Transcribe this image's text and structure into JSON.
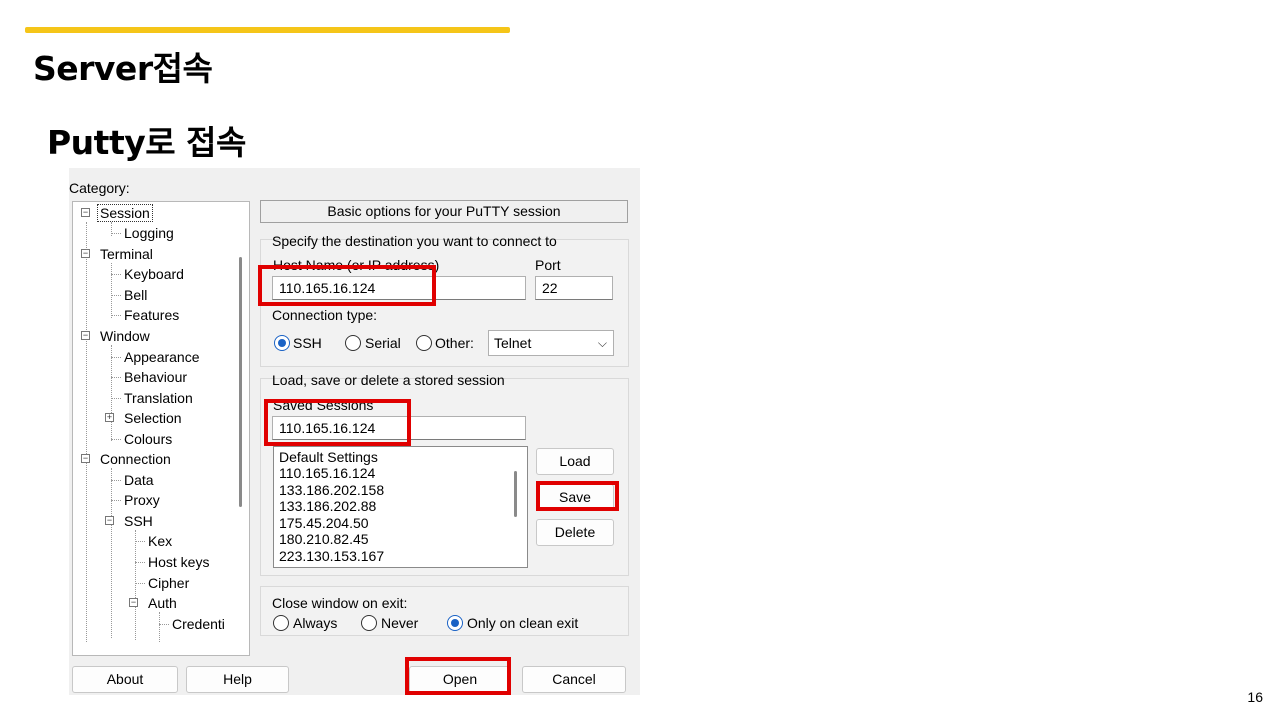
{
  "slide": {
    "title": "Server접속",
    "subtitle": "Putty로 접속",
    "page_number": "16",
    "accent_color": "#f5c518",
    "highlight_color": "#e00000"
  },
  "dialog": {
    "category_label": "Category:",
    "tree": [
      {
        "label": "Session",
        "toggle": "minus",
        "selected": true
      },
      {
        "label": "Logging"
      },
      {
        "label": "Terminal",
        "toggle": "minus"
      },
      {
        "label": "Keyboard"
      },
      {
        "label": "Bell"
      },
      {
        "label": "Features"
      },
      {
        "label": "Window",
        "toggle": "minus"
      },
      {
        "label": "Appearance"
      },
      {
        "label": "Behaviour"
      },
      {
        "label": "Translation"
      },
      {
        "label": "Selection",
        "toggle": "plus"
      },
      {
        "label": "Colours"
      },
      {
        "label": "Connection",
        "toggle": "minus"
      },
      {
        "label": "Data"
      },
      {
        "label": "Proxy"
      },
      {
        "label": "SSH",
        "toggle": "minus"
      },
      {
        "label": "Kex"
      },
      {
        "label": "Host keys"
      },
      {
        "label": "Cipher"
      },
      {
        "label": "Auth",
        "toggle": "minus"
      },
      {
        "label": "Credenti"
      }
    ],
    "header": "Basic options for your PuTTY session",
    "destination": {
      "group_label": "Specify the destination you want to connect to",
      "host_label": "Host Name (or IP address)",
      "host_value": "110.165.16.124",
      "port_label": "Port",
      "port_value": "22"
    },
    "connection_type": {
      "label": "Connection type:",
      "options": [
        "SSH",
        "Serial",
        "Other:"
      ],
      "selected": "SSH",
      "other_select_value": "Telnet"
    },
    "sessions": {
      "group_label": "Load, save or delete a stored session",
      "saved_label": "Saved Sessions",
      "saved_value": "110.165.16.124",
      "list": [
        "Default Settings",
        "110.165.16.124",
        "133.186.202.158",
        "133.186.202.88",
        "175.45.204.50",
        "180.210.82.45",
        "223.130.153.167"
      ],
      "load_label": "Load",
      "save_label": "Save",
      "delete_label": "Delete"
    },
    "close_window": {
      "label": "Close window on exit:",
      "options": [
        "Always",
        "Never",
        "Only on clean exit"
      ],
      "selected": "Only on clean exit"
    },
    "buttons": {
      "about": "About",
      "help": "Help",
      "open": "Open",
      "cancel": "Cancel"
    }
  }
}
